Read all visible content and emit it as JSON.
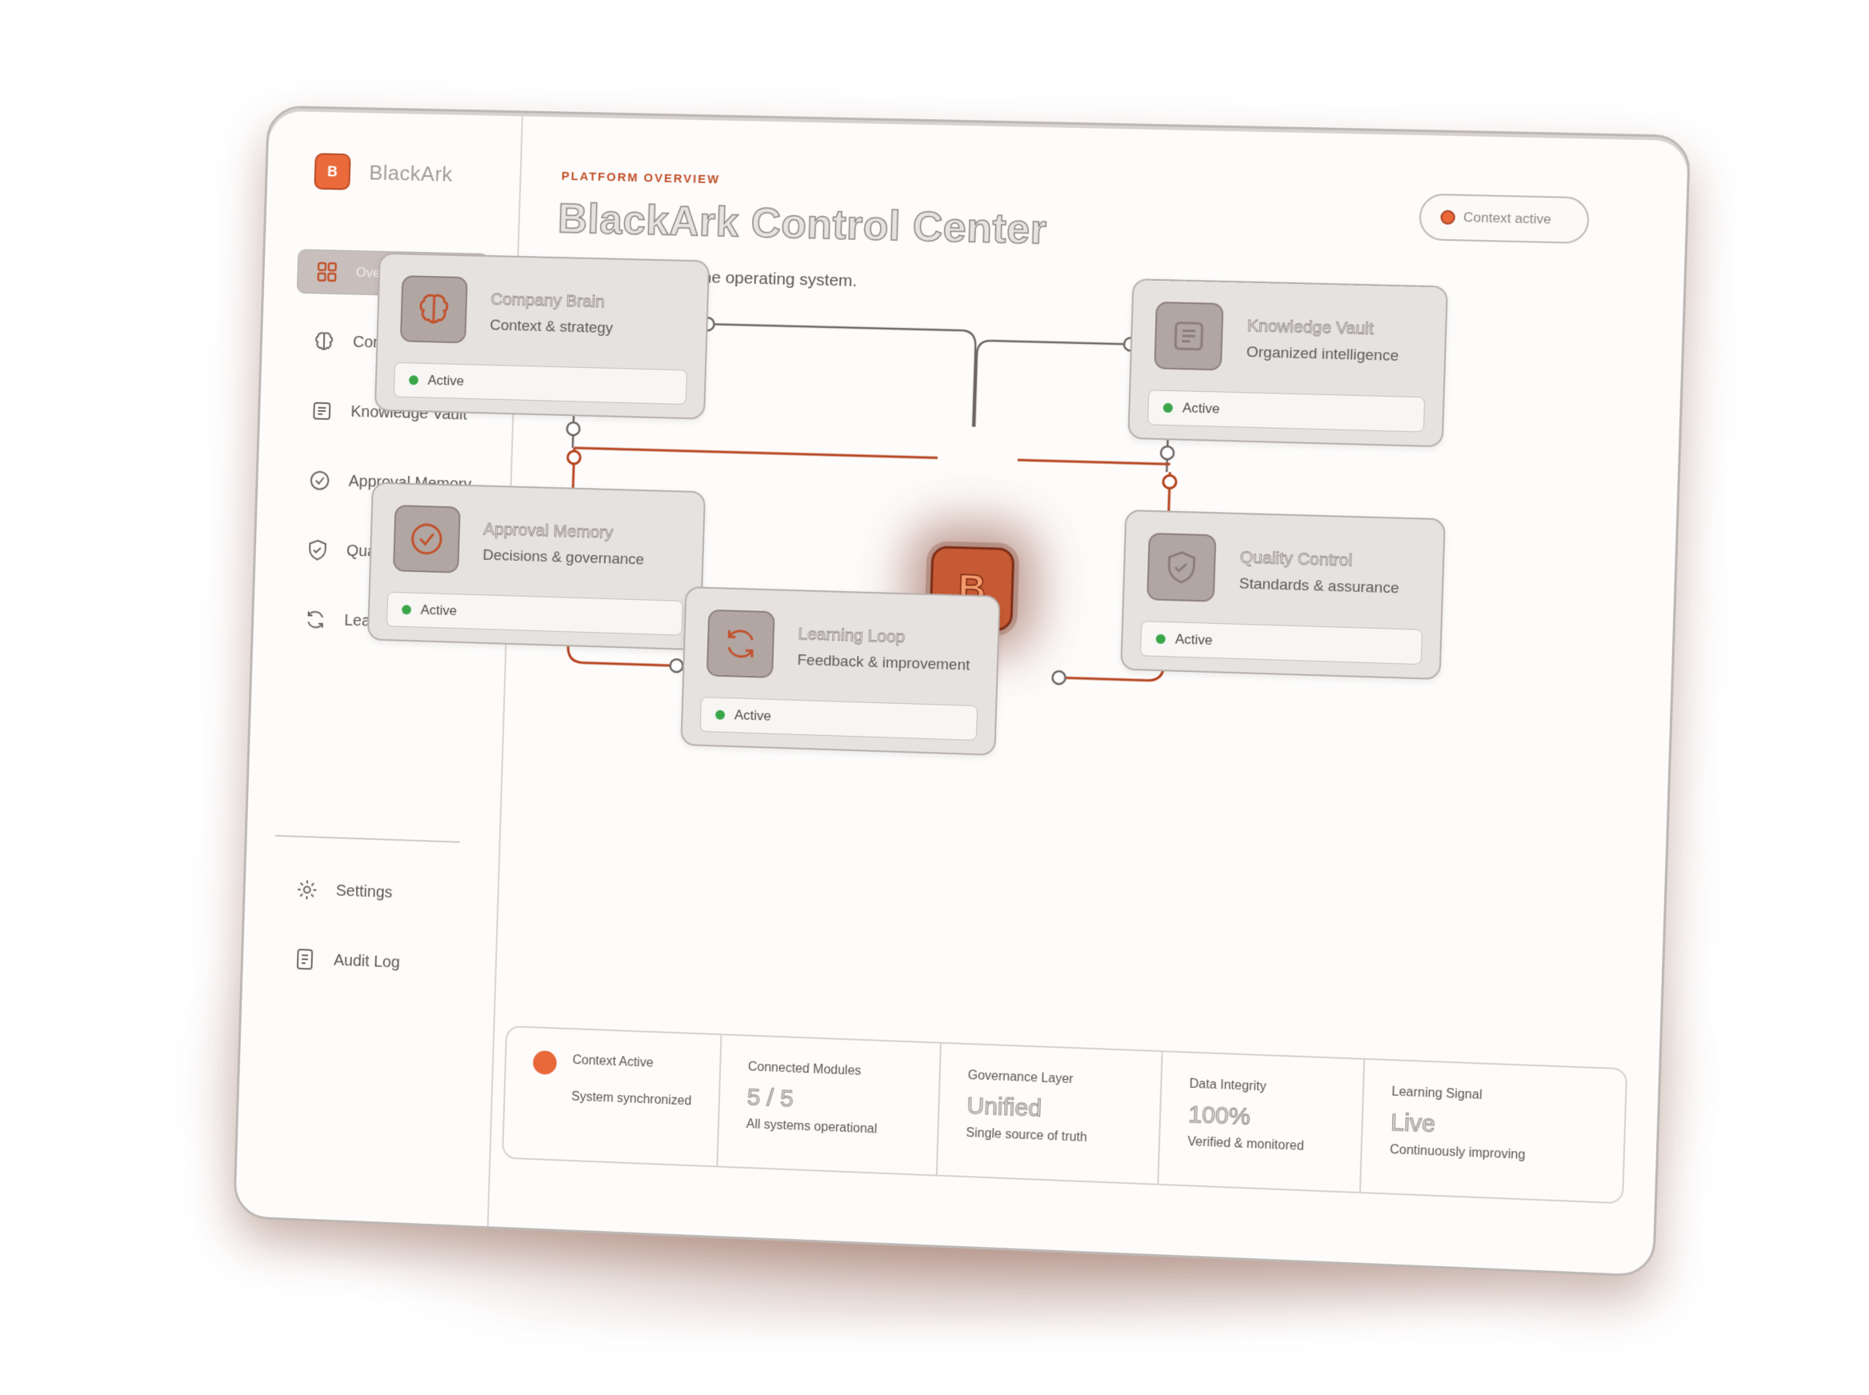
{
  "brand": {
    "name": "BlackArk",
    "logo_letter": "B"
  },
  "sidebar": {
    "items": [
      {
        "label": "Overview",
        "icon": "grid-icon",
        "active": true
      },
      {
        "label": "Company Brain",
        "icon": "brain-icon"
      },
      {
        "label": "Knowledge Vault",
        "icon": "vault-icon"
      },
      {
        "label": "Approval Memory",
        "icon": "check-circle-icon"
      },
      {
        "label": "Quality Control",
        "icon": "shield-icon"
      },
      {
        "label": "Learning Loop",
        "icon": "refresh-icon"
      }
    ],
    "bottom": [
      {
        "label": "Settings",
        "icon": "gear-icon"
      },
      {
        "label": "Audit Log",
        "icon": "document-icon"
      }
    ]
  },
  "header": {
    "eyebrow": "PLATFORM OVERVIEW",
    "title": "BlackArk Control Center",
    "subtitle": "All core modules. One operating system.",
    "status": "Context active"
  },
  "hub": {
    "letter": "B"
  },
  "modules": [
    {
      "title": "Company Brain",
      "subtitle": "Context & strategy",
      "status": "Active",
      "icon": "brain-icon"
    },
    {
      "title": "Knowledge Vault",
      "subtitle": "Organized intelligence",
      "status": "Active",
      "icon": "vault-icon"
    },
    {
      "title": "Approval Memory",
      "subtitle": "Decisions & governance",
      "status": "Active",
      "icon": "check-circle-icon"
    },
    {
      "title": "Quality Control",
      "subtitle": "Standards & assurance",
      "status": "Active",
      "icon": "shield-icon"
    },
    {
      "title": "Learning Loop",
      "subtitle": "Feedback & improvement",
      "status": "Active",
      "icon": "refresh-icon"
    }
  ],
  "stats": {
    "context": {
      "label": "Context Active",
      "detail": "System synchronized"
    },
    "items": [
      {
        "label": "Connected Modules",
        "value": "5 / 5",
        "detail": "All systems operational"
      },
      {
        "label": "Governance Layer",
        "value": "Unified",
        "detail": "Single source of truth"
      },
      {
        "label": "Data Integrity",
        "value": "100%",
        "detail": "Verified & monitored"
      },
      {
        "label": "Learning Signal",
        "value": "Live",
        "detail": "Continuously improving"
      }
    ]
  },
  "colors": {
    "accent": "#e8683a",
    "accent_dark": "#a84322",
    "active_green": "#3aa64a"
  }
}
